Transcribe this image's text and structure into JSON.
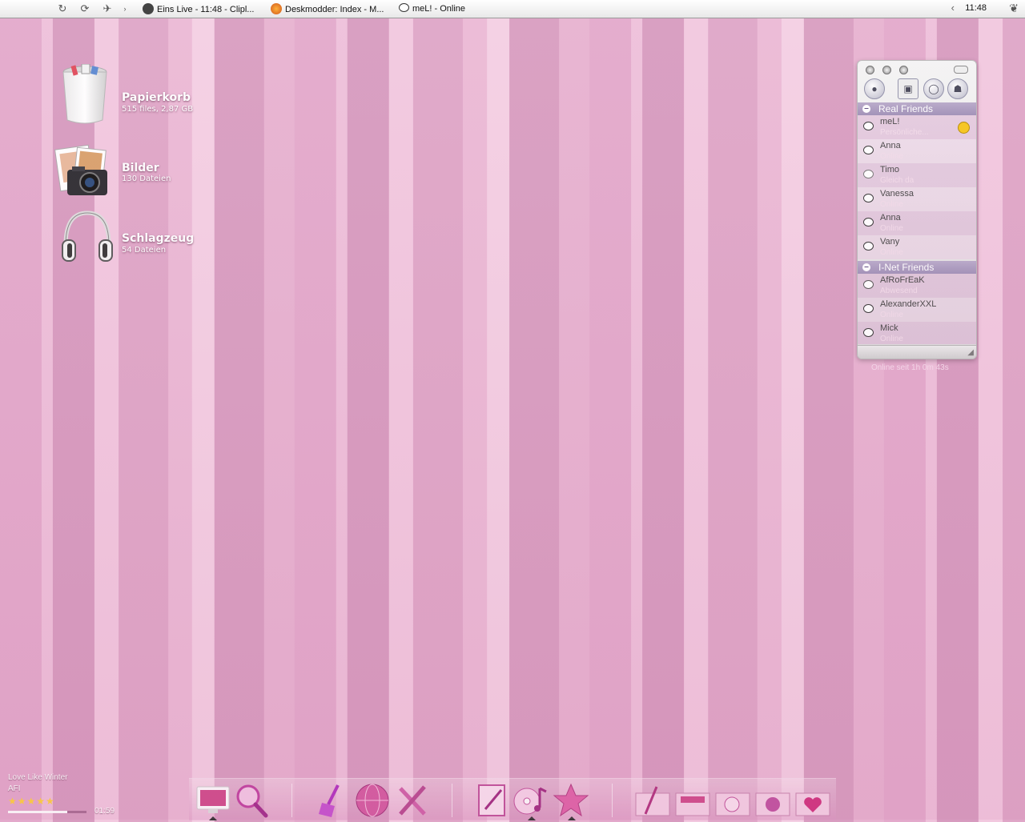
{
  "taskbar": {
    "tasks": [
      {
        "label": "Eins Live - 11:48 - Clipl..."
      },
      {
        "label": "Deskmodder: Index - M..."
      },
      {
        "label": "meL! - Online"
      }
    ],
    "arrow": "‹",
    "clock": "11:48"
  },
  "desktop_icons": [
    {
      "label": "Papierkorb",
      "sub": "515 files, 2,87 GB"
    },
    {
      "label": "Bilder",
      "sub": "130 Dateien"
    },
    {
      "label": "Schlagzeug",
      "sub": "54 Dateien"
    }
  ],
  "messenger": {
    "groups": [
      {
        "label": "Real Friends",
        "contacts": [
          {
            "name": "meL!",
            "status": "Persönliche..."
          },
          {
            "name": "Anna",
            "status": "Online"
          },
          {
            "name": "Timo",
            "status": "Gleich da"
          },
          {
            "name": "Vanessa",
            "status": "Online"
          },
          {
            "name": "Anna",
            "status": "Online"
          },
          {
            "name": "Vany",
            "status": "Online"
          }
        ]
      },
      {
        "label": "I-Net Friends",
        "contacts": [
          {
            "name": "AfRoFrEaK",
            "status": "Abwesend"
          },
          {
            "name": "AlexanderXXL",
            "status": "Online"
          },
          {
            "name": "Mick",
            "status": "Online"
          }
        ]
      }
    ],
    "online_since": "Online seit 1h 0m 43s"
  },
  "player": {
    "title": "Love Like Winter",
    "artist": "AFI",
    "rating": 5,
    "stars": "★★★★★",
    "progress": 0.75,
    "time": "01:59"
  },
  "colors": {
    "accent": "#e3a9cb",
    "group_header": "#a596bc",
    "star": "#ffd23a"
  }
}
